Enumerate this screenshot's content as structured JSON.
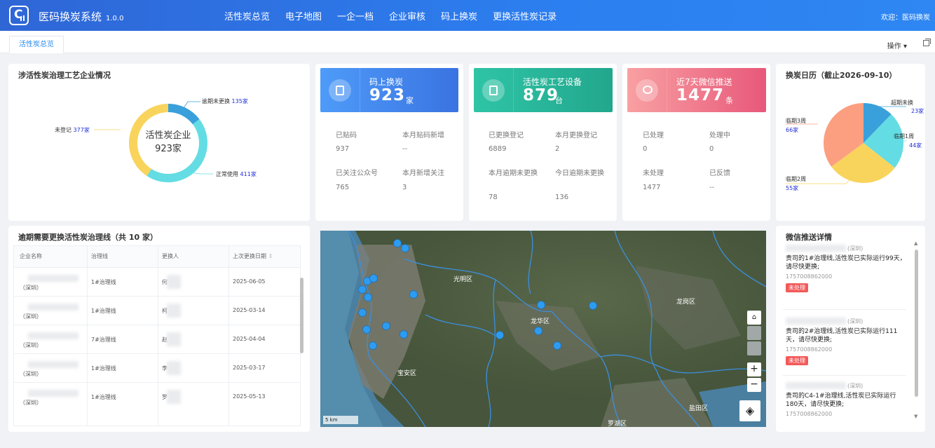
{
  "app": {
    "title": "医码换炭系统",
    "version": "1.0.0",
    "welcome": "欢迎：医码换炭"
  },
  "nav": [
    "活性炭总览",
    "电子地图",
    "一企一档",
    "企业审核",
    "码上换炭",
    "更换活性炭记录"
  ],
  "tab": {
    "label": "活性炭总览",
    "ops": "操作 ▾"
  },
  "donut": {
    "title": "涉活性炭治理工艺企业情况",
    "center_line1": "活性炭企业",
    "center_line2": "923家",
    "segments": [
      {
        "name": "逾期未更换",
        "value": "135家",
        "count": 135,
        "color": "#3aa0db"
      },
      {
        "name": "正常使用",
        "value": "411家",
        "count": 411,
        "color": "#63dde3"
      },
      {
        "name": "未登记",
        "value": "377家",
        "count": 377,
        "color": "#f9d45c"
      }
    ]
  },
  "stats": [
    {
      "name": "码上换炭",
      "num": "923",
      "unit": "家",
      "color_from": "#4e9bf8",
      "color_to": "#3a73e2",
      "items": [
        {
          "k": "已贴码",
          "v": "937"
        },
        {
          "k": "本月贴码新增",
          "v": "--"
        },
        {
          "k": "已关注公众号",
          "v": "765"
        },
        {
          "k": "本月新增关注",
          "v": "3"
        }
      ]
    },
    {
      "name": "活性炭工艺设备",
      "num": "879",
      "unit": "台",
      "color_from": "#2fc4a6",
      "color_to": "#22a78d",
      "items": [
        {
          "k": "已更换登记",
          "v": "6889"
        },
        {
          "k": "本月更换登记",
          "v": "2"
        },
        {
          "k": "本月逾期未更换",
          "v": "78"
        },
        {
          "k": "今日逾期未更换",
          "v": "136"
        }
      ]
    },
    {
      "name": "近7天微信推送",
      "num": "1477",
      "unit": "条",
      "color_from": "#f8a0a2",
      "color_to": "#e8587a",
      "items": [
        {
          "k": "已处理",
          "v": "0"
        },
        {
          "k": "处理中",
          "v": "0"
        },
        {
          "k": "未处理",
          "v": "1477"
        },
        {
          "k": "已反馈",
          "v": "--"
        }
      ]
    }
  ],
  "pie": {
    "title": "换炭日历（截止2026-09-10）",
    "slices": [
      {
        "name": "超期未换",
        "value": "23家",
        "count": 23,
        "color": "#3aa0db"
      },
      {
        "name": "临期1周",
        "value": "44家",
        "count": 44,
        "color": "#63dde3"
      },
      {
        "name": "临期2周",
        "value": "55家",
        "count": 55,
        "color": "#f9d45c"
      },
      {
        "name": "临期3周",
        "value": "66家",
        "count": 66,
        "color": "#fb9f80"
      }
    ]
  },
  "overdue": {
    "title": "逾期需要更换活性炭治理线（共 10 家）",
    "headers": [
      "企业名称",
      "治理线",
      "更换人",
      "上次更换日期"
    ],
    "rows": [
      {
        "company": "（深圳）",
        "line": "1#治理线",
        "person": "何",
        "date": "2025-06-05"
      },
      {
        "company": "（深圳）",
        "line": "1#治理线",
        "person": "柯",
        "date": "2025-03-14"
      },
      {
        "company": "（深圳）",
        "line": "7#治理线",
        "person": "赵",
        "date": "2025-04-04"
      },
      {
        "company": "（深圳）",
        "line": "1#治理线",
        "person": "李",
        "date": "2025-03-17"
      },
      {
        "company": "（深圳）",
        "line": "1#治理线",
        "person": "罗",
        "date": "2025-05-13"
      }
    ]
  },
  "map": {
    "labels": [
      "光明区",
      "龙华区",
      "龙岗区",
      "宝安区",
      "盐田区",
      "罗湖区"
    ],
    "scale": "5 km",
    "zoom_in": "+",
    "zoom_out": "−",
    "marker_color": "#2d9cf0"
  },
  "wechat": {
    "title": "微信推送详情",
    "items": [
      {
        "org": "(深圳)",
        "text": "贵司的1#治理线,活性炭已实际运行99天，请尽快更换;",
        "phone": "1757008862000",
        "status": "未处理"
      },
      {
        "org": "(深圳)",
        "text": "贵司的2#治理线,活性炭已实际运行111天，请尽快更换;",
        "phone": "1757008862000",
        "status": "未处理"
      },
      {
        "org": "(深圳)",
        "text": "贵司的C4-1#治理线,活性炭已实际运行180天，请尽快更换;",
        "phone": "1757008862000",
        "status": ""
      }
    ]
  }
}
